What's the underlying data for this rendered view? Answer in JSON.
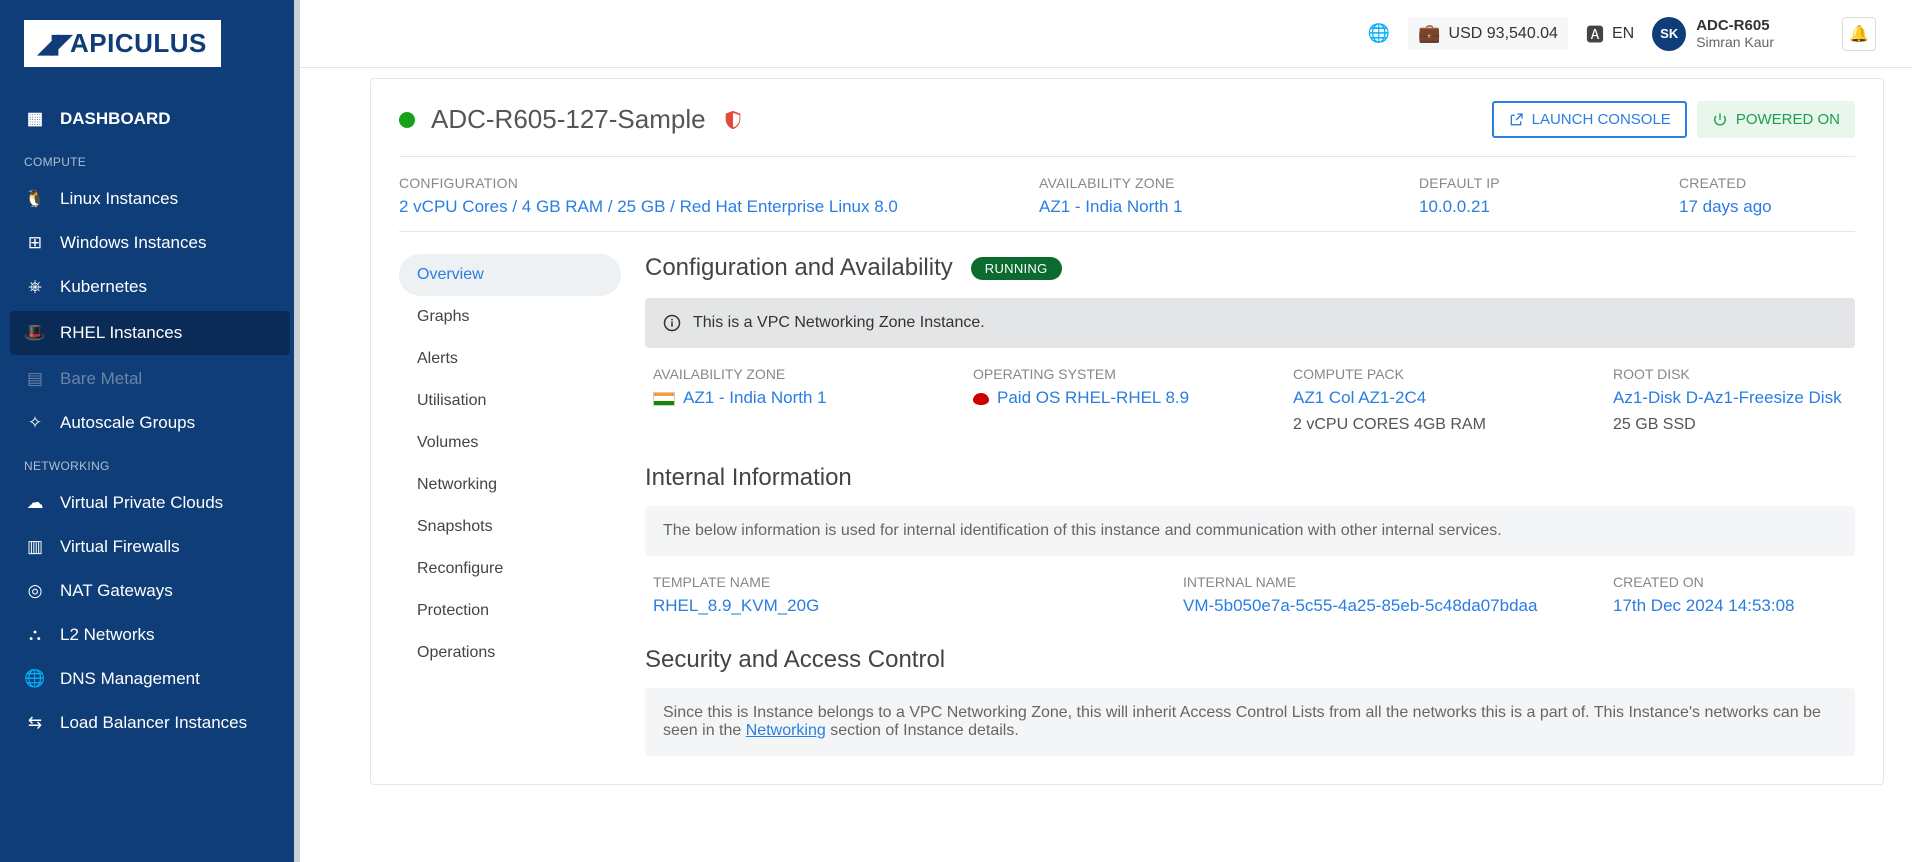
{
  "brand": "APICULUS",
  "sidebar": {
    "dashboard": "DASHBOARD",
    "sections": {
      "compute": "COMPUTE",
      "networking": "NETWORKING"
    },
    "items": {
      "linux": "Linux Instances",
      "windows": "Windows Instances",
      "k8s": "Kubernetes",
      "rhel": "RHEL Instances",
      "baremetal": "Bare Metal",
      "autoscale": "Autoscale Groups",
      "vpc": "Virtual Private Clouds",
      "vfw": "Virtual Firewalls",
      "nat": "NAT Gateways",
      "l2": "L2 Networks",
      "dns": "DNS Management",
      "lb": "Load Balancer Instances"
    }
  },
  "topbar": {
    "balance": "USD 93,540.04",
    "lang": "EN",
    "avatar_initials": "SK",
    "account": "ADC-R605",
    "username": "Simran Kaur"
  },
  "instance": {
    "name": "ADC-R605-127-Sample",
    "launch_console": "LAUNCH CONSOLE",
    "power_state": "POWERED ON"
  },
  "summary": {
    "config_label": "CONFIGURATION",
    "config_value": "2 vCPU Cores / 4 GB RAM / 25 GB / Red Hat Enterprise Linux 8.0",
    "zone_label": "AVAILABILITY ZONE",
    "zone_value": "AZ1 - India North 1",
    "ip_label": "DEFAULT IP",
    "ip_value": "10.0.0.21",
    "created_label": "CREATED",
    "created_value": "17 days ago"
  },
  "tabs": {
    "overview": "Overview",
    "graphs": "Graphs",
    "alerts": "Alerts",
    "utilisation": "Utilisation",
    "volumes": "Volumes",
    "networking": "Networking",
    "snapshots": "Snapshots",
    "reconfigure": "Reconfigure",
    "protection": "Protection",
    "operations": "Operations"
  },
  "config_section": {
    "title": "Configuration and Availability",
    "status": "RUNNING",
    "notice": "This is a VPC Networking Zone Instance.",
    "cols": {
      "zone_label": "AVAILABILITY ZONE",
      "zone_value": "AZ1 - India North 1",
      "os_label": "OPERATING SYSTEM",
      "os_value": "Paid OS RHEL-RHEL 8.9",
      "pack_label": "COMPUTE PACK",
      "pack_value": "AZ1 Col AZ1-2C4",
      "pack_sub": "2 vCPU CORES 4GB RAM",
      "disk_label": "ROOT DISK",
      "disk_value": "Az1-Disk D-Az1-Freesize Disk",
      "disk_sub": "25 GB SSD"
    }
  },
  "internal": {
    "title": "Internal Information",
    "desc": "The below information is used for internal identification of this instance and communication with other internal services.",
    "template_label": "TEMPLATE NAME",
    "template_value": "RHEL_8.9_KVM_20G",
    "internal_label": "INTERNAL NAME",
    "internal_value": "VM-5b050e7a-5c55-4a25-85eb-5c48da07bdaa",
    "created_label": "CREATED ON",
    "created_value": "17th Dec 2024 14:53:08"
  },
  "security": {
    "title": "Security and Access Control",
    "desc_pre": "Since this is Instance belongs to a VPC Networking Zone, this will inherit Access Control Lists from all the networks this is a part of. This Instance's networks can be seen in the ",
    "link": "Networking",
    "desc_post": " section of Instance details."
  }
}
